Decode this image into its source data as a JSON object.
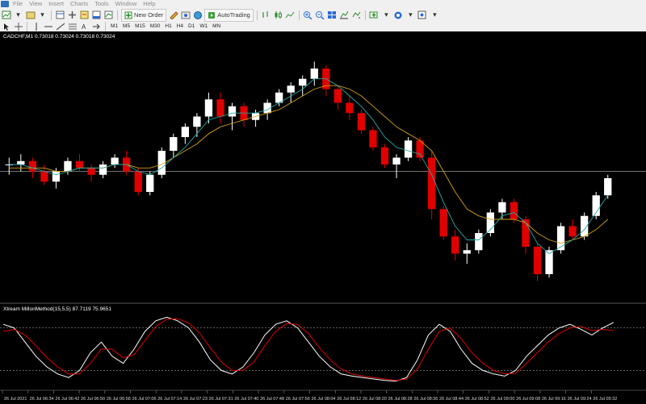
{
  "menu": [
    "File",
    "View",
    "Insert",
    "Charts",
    "Tools",
    "Window",
    "Help"
  ],
  "toolbar": {
    "new_order": "New Order",
    "auto_trading": "AutoTrading"
  },
  "timeframes": [
    "M1",
    "M5",
    "M15",
    "M30",
    "H1",
    "H4",
    "D1",
    "W1",
    "MN"
  ],
  "chart": {
    "symbol_info": "CADCHF,M1  0.73018 0.73024 0.73018 0.73024",
    "indicator_info": "Xtream MillonMethod(15,5,5) 87.7119 75.9651",
    "time_labels": [
      "26 Jul 2021",
      "26 Jul 06:34",
      "26 Jul 06:42",
      "26 Jul 06:50",
      "26 Jul 06:58",
      "26 Jul 07:06",
      "26 Jul 07:14",
      "26 Jul 07:23",
      "26 Jul 07:31",
      "26 Jul 07:40",
      "26 Jul 07:48",
      "26 Jul 07:56",
      "26 Jul 08:04",
      "26 Jul 08:12",
      "26 Jul 08:20",
      "26 Jul 08:28",
      "26 Jul 08:36",
      "26 Jul 08:44",
      "26 Jul 08:52",
      "26 Jul 09:00",
      "26 Jul 09:08",
      "26 Jul 09:16",
      "26 Jul 09:24",
      "26 Jul 09:32"
    ],
    "colors": {
      "bull": "#ffffff",
      "bear": "#e00000",
      "ma_slow": "#d4a017",
      "ma_fast": "#2aa8a8",
      "osc_main": "#ffffff",
      "osc_signal": "#e00000"
    }
  },
  "chart_data": [
    {
      "type": "candlestick",
      "series": [
        {
          "name": "CADCHF,M1",
          "values": [
            [
              0.7292,
              0.7294,
              0.7289,
              0.7292
            ],
            [
              0.7292,
              0.7295,
              0.729,
              0.7293
            ],
            [
              0.7293,
              0.7294,
              0.7288,
              0.729
            ],
            [
              0.729,
              0.7292,
              0.7286,
              0.7287
            ],
            [
              0.7287,
              0.7291,
              0.7285,
              0.729
            ],
            [
              0.729,
              0.7294,
              0.7289,
              0.7293
            ],
            [
              0.7293,
              0.7295,
              0.729,
              0.7291
            ],
            [
              0.7291,
              0.7292,
              0.7287,
              0.7289
            ],
            [
              0.7289,
              0.7293,
              0.7288,
              0.7292
            ],
            [
              0.7292,
              0.7295,
              0.7291,
              0.7294
            ],
            [
              0.7294,
              0.7296,
              0.7289,
              0.729
            ],
            [
              0.729,
              0.7291,
              0.7283,
              0.7284
            ],
            [
              0.7284,
              0.729,
              0.7283,
              0.7289
            ],
            [
              0.7289,
              0.7297,
              0.7288,
              0.7296
            ],
            [
              0.7296,
              0.7301,
              0.7294,
              0.73
            ],
            [
              0.73,
              0.7304,
              0.7298,
              0.7303
            ],
            [
              0.7303,
              0.7307,
              0.73,
              0.7306
            ],
            [
              0.7306,
              0.7313,
              0.7304,
              0.7311
            ],
            [
              0.7311,
              0.7313,
              0.7304,
              0.7306
            ],
            [
              0.7306,
              0.731,
              0.7302,
              0.7309
            ],
            [
              0.7309,
              0.731,
              0.7303,
              0.7305
            ],
            [
              0.7305,
              0.7308,
              0.7303,
              0.7307
            ],
            [
              0.7307,
              0.7311,
              0.7305,
              0.731
            ],
            [
              0.731,
              0.7314,
              0.7309,
              0.7313
            ],
            [
              0.7313,
              0.7316,
              0.731,
              0.7315
            ],
            [
              0.7315,
              0.7318,
              0.7312,
              0.7317
            ],
            [
              0.7317,
              0.7322,
              0.7315,
              0.732
            ],
            [
              0.732,
              0.7321,
              0.7312,
              0.7314
            ],
            [
              0.7314,
              0.7315,
              0.7308,
              0.731
            ],
            [
              0.731,
              0.7312,
              0.7305,
              0.7307
            ],
            [
              0.7307,
              0.7308,
              0.7301,
              0.7302
            ],
            [
              0.7302,
              0.7303,
              0.7296,
              0.7297
            ],
            [
              0.7297,
              0.7298,
              0.7291,
              0.7292
            ],
            [
              0.7292,
              0.7295,
              0.7288,
              0.7294
            ],
            [
              0.7294,
              0.73,
              0.7293,
              0.7299
            ],
            [
              0.7299,
              0.73,
              0.7293,
              0.7294
            ],
            [
              0.7294,
              0.7296,
              0.7276,
              0.7279
            ],
            [
              0.7279,
              0.728,
              0.727,
              0.7271
            ],
            [
              0.7271,
              0.7273,
              0.7264,
              0.7266
            ],
            [
              0.7266,
              0.7269,
              0.7263,
              0.7267
            ],
            [
              0.7267,
              0.7273,
              0.7266,
              0.7272
            ],
            [
              0.7272,
              0.7279,
              0.7271,
              0.7278
            ],
            [
              0.7278,
              0.7282,
              0.7276,
              0.7281
            ],
            [
              0.7281,
              0.7282,
              0.7275,
              0.7276
            ],
            [
              0.7276,
              0.7277,
              0.7266,
              0.7268
            ],
            [
              0.7268,
              0.7269,
              0.7258,
              0.726
            ],
            [
              0.726,
              0.7268,
              0.7259,
              0.7267
            ],
            [
              0.7267,
              0.7275,
              0.7266,
              0.7274
            ],
            [
              0.7274,
              0.7276,
              0.727,
              0.7271
            ],
            [
              0.7271,
              0.7278,
              0.727,
              0.7277
            ],
            [
              0.7277,
              0.7284,
              0.7276,
              0.7283
            ],
            [
              0.7283,
              0.7289,
              0.7282,
              0.7288
            ]
          ]
        }
      ],
      "indicators": [
        {
          "name": "MA slow",
          "values": [
            0.7291,
            0.7291,
            0.7291,
            0.7291,
            0.729,
            0.729,
            0.7291,
            0.7291,
            0.7291,
            0.7292,
            0.7292,
            0.7291,
            0.7291,
            0.7292,
            0.7294,
            0.7296,
            0.7298,
            0.7301,
            0.7303,
            0.7304,
            0.7305,
            0.7306,
            0.7307,
            0.7308,
            0.731,
            0.7312,
            0.7314,
            0.7315,
            0.7315,
            0.7314,
            0.7312,
            0.7309,
            0.7306,
            0.7303,
            0.7301,
            0.7299,
            0.7296,
            0.729,
            0.7284,
            0.7279,
            0.7277,
            0.7276,
            0.7276,
            0.7276,
            0.7275,
            0.7272,
            0.727,
            0.7269,
            0.727,
            0.7271,
            0.7273,
            0.7276
          ]
        },
        {
          "name": "MA fast",
          "values": [
            0.7292,
            0.7292,
            0.7291,
            0.729,
            0.7289,
            0.729,
            0.7291,
            0.7291,
            0.7291,
            0.7292,
            0.7292,
            0.729,
            0.7289,
            0.7291,
            0.7294,
            0.7297,
            0.7301,
            0.7305,
            0.7306,
            0.7307,
            0.7307,
            0.7307,
            0.7308,
            0.731,
            0.7312,
            0.7314,
            0.7317,
            0.7317,
            0.7315,
            0.7312,
            0.7309,
            0.7305,
            0.73,
            0.7297,
            0.7296,
            0.7295,
            0.7289,
            0.7281,
            0.7274,
            0.727,
            0.727,
            0.7273,
            0.7277,
            0.7278,
            0.7275,
            0.7269,
            0.7266,
            0.7268,
            0.727,
            0.7273,
            0.7278,
            0.7283
          ]
        }
      ],
      "y_level": 0.729
    },
    {
      "type": "line",
      "title": "Xtream MillonMethod(15,5,5) 87.7119 75.9651",
      "ylim": [
        0,
        100
      ],
      "levels": [
        80,
        20
      ],
      "series": [
        {
          "name": "main",
          "values": [
            85,
            80,
            60,
            40,
            25,
            15,
            10,
            20,
            45,
            60,
            40,
            30,
            50,
            75,
            90,
            95,
            90,
            80,
            60,
            35,
            20,
            15,
            25,
            45,
            70,
            85,
            90,
            80,
            60,
            40,
            25,
            15,
            12,
            10,
            8,
            6,
            5,
            10,
            35,
            70,
            85,
            75,
            50,
            30,
            20,
            15,
            12,
            20,
            40,
            55,
            70,
            80,
            85,
            78,
            70,
            80,
            87.7
          ]
        },
        {
          "name": "signal",
          "values": [
            75,
            78,
            70,
            55,
            38,
            25,
            15,
            15,
            30,
            50,
            50,
            38,
            42,
            62,
            82,
            92,
            93,
            87,
            73,
            52,
            32,
            20,
            20,
            32,
            55,
            75,
            86,
            85,
            72,
            52,
            35,
            22,
            15,
            12,
            10,
            8,
            6,
            8,
            22,
            50,
            75,
            80,
            65,
            45,
            30,
            20,
            15,
            16,
            30,
            45,
            60,
            72,
            80,
            82,
            76,
            78,
            76.0
          ]
        }
      ]
    }
  ]
}
